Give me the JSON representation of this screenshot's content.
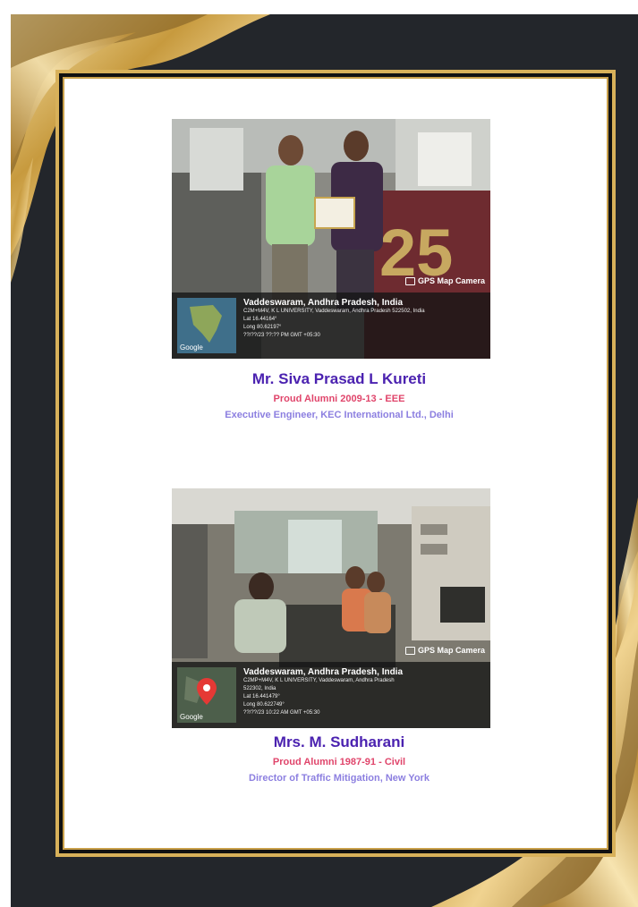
{
  "colors": {
    "background": "#23262b",
    "gold": "#d8b15a",
    "name": "#4b22b0",
    "alumni": "#e0456b",
    "role": "#8c7fe0"
  },
  "profiles": [
    {
      "name": "Mr. Siva Prasad L Kureti",
      "alumni": "Proud Alumni 2009-13 - EEE",
      "role": "Executive Engineer, KEC International Ltd., Delhi",
      "photo": {
        "gps_tag": "GPS Map Camera",
        "location": "Vaddeswaram, Andhra Pradesh, India",
        "details": [
          "C2M+M4V, K L UNIVERSITY, Vaddeswaram, Andhra Pradesh 522502, India",
          "Lat 16.44164°",
          "Long 80.62197°",
          "??/??/23 ??:?? PM GMT +05:30"
        ],
        "map_label": "Google",
        "sign_text": "25"
      }
    },
    {
      "name": "Mrs. M. Sudharani",
      "alumni": "Proud Alumni 1987-91 - Civil",
      "role": "Director of Traffic Mitigation, New York",
      "photo": {
        "gps_tag": "GPS Map Camera",
        "location": "Vaddeswaram, Andhra Pradesh, India",
        "details": [
          "C2MP+M4V, K L UNIVERSITY, Vaddeswaram, Andhra Pradesh",
          "522302, India",
          "Lat 16.441479°",
          "Long 80.622749°",
          "??/??/23 10:22 AM GMT +05:30"
        ],
        "map_label": "Google"
      }
    }
  ]
}
